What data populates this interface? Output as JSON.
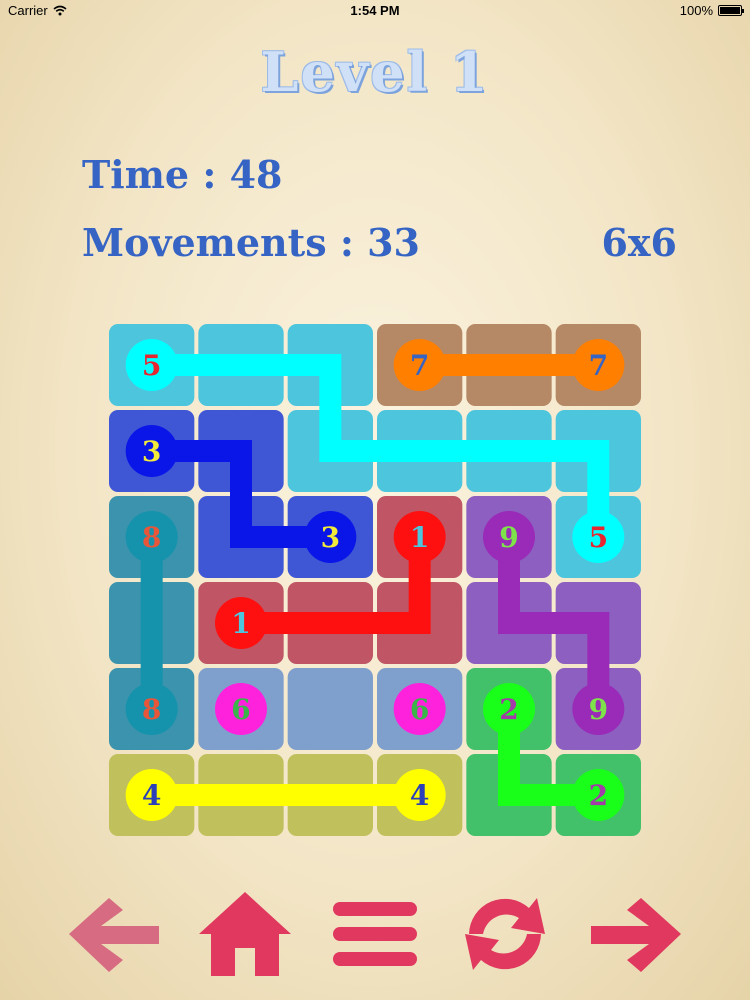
{
  "status_bar": {
    "carrier": "Carrier",
    "time": "1:54 PM",
    "battery": "100%"
  },
  "header": {
    "level_title": "Level  1"
  },
  "stats": {
    "time": "Time : 48",
    "movements": "Movements : 33",
    "grid_size": "6x6"
  },
  "board": {
    "rows": 6,
    "cols": 6,
    "cell_colors": [
      [
        "#4dc5dd",
        "#4dc5dd",
        "#4dc5dd",
        "#b58866",
        "#b58866",
        "#b58866"
      ],
      [
        "#3f57d4",
        "#3f57d4",
        "#4dc5dd",
        "#4dc5dd",
        "#4dc5dd",
        "#4dc5dd"
      ],
      [
        "#3b93ad",
        "#3f57d4",
        "#3f57d4",
        "#bf5565",
        "#8c5fc0",
        "#4dc5dd"
      ],
      [
        "#3b93ad",
        "#bf5565",
        "#bf5565",
        "#bf5565",
        "#8c5fc0",
        "#8c5fc0"
      ],
      [
        "#3b93ad",
        "#7f9fcd",
        "#7f9fcd",
        "#7f9fcd",
        "#42c06a",
        "#8c5fc0"
      ],
      [
        "#c0c05c",
        "#c0c05c",
        "#c0c05c",
        "#c0c05c",
        "#42c06a",
        "#42c06a"
      ]
    ],
    "paths": [
      {
        "color": "#00ffff",
        "cells": [
          [
            0,
            0
          ],
          [
            0,
            1
          ],
          [
            0,
            2
          ],
          [
            1,
            2
          ],
          [
            1,
            3
          ],
          [
            1,
            4
          ],
          [
            1,
            5
          ],
          [
            2,
            5
          ]
        ]
      },
      {
        "color": "#ff7f00",
        "cells": [
          [
            0,
            3
          ],
          [
            0,
            4
          ],
          [
            0,
            5
          ]
        ]
      },
      {
        "color": "#0a16e8",
        "cells": [
          [
            1,
            0
          ],
          [
            1,
            1
          ],
          [
            2,
            1
          ],
          [
            2,
            2
          ]
        ]
      },
      {
        "color": "#ff1010",
        "cells": [
          [
            2,
            3
          ],
          [
            3,
            3
          ],
          [
            3,
            2
          ],
          [
            3,
            1
          ]
        ]
      },
      {
        "color": "#9a2ab8",
        "cells": [
          [
            2,
            4
          ],
          [
            3,
            4
          ],
          [
            3,
            5
          ],
          [
            4,
            5
          ]
        ]
      },
      {
        "color": "#1593ac",
        "cells": [
          [
            2,
            0
          ],
          [
            3,
            0
          ],
          [
            4,
            0
          ]
        ]
      },
      {
        "color": "#ffff00",
        "cells": [
          [
            5,
            0
          ],
          [
            5,
            1
          ],
          [
            5,
            2
          ],
          [
            5,
            3
          ]
        ]
      },
      {
        "color": "#19ff19",
        "cells": [
          [
            4,
            4
          ],
          [
            5,
            4
          ],
          [
            5,
            5
          ]
        ]
      }
    ],
    "dots": [
      {
        "row": 0,
        "col": 0,
        "label": "5",
        "dot_color": "#00ffff",
        "text_color": "#e8242e"
      },
      {
        "row": 2,
        "col": 5,
        "label": "5",
        "dot_color": "#00ffff",
        "text_color": "#e8242e"
      },
      {
        "row": 0,
        "col": 3,
        "label": "7",
        "dot_color": "#ff7f00",
        "text_color": "#3564c4"
      },
      {
        "row": 0,
        "col": 5,
        "label": "7",
        "dot_color": "#ff7f00",
        "text_color": "#3564c4"
      },
      {
        "row": 1,
        "col": 0,
        "label": "3",
        "dot_color": "#0a16e8",
        "text_color": "#f2ea3a"
      },
      {
        "row": 2,
        "col": 2,
        "label": "3",
        "dot_color": "#0a16e8",
        "text_color": "#f2ea3a"
      },
      {
        "row": 2,
        "col": 3,
        "label": "1",
        "dot_color": "#ff1010",
        "text_color": "#4dc5dd"
      },
      {
        "row": 3,
        "col": 1,
        "label": "1",
        "dot_color": "#ff1010",
        "text_color": "#4dc5dd"
      },
      {
        "row": 2,
        "col": 0,
        "label": "8",
        "dot_color": "#1593ac",
        "text_color": "#e8563a"
      },
      {
        "row": 4,
        "col": 0,
        "label": "8",
        "dot_color": "#1593ac",
        "text_color": "#e8563a"
      },
      {
        "row": 2,
        "col": 4,
        "label": "9",
        "dot_color": "#9a2ab8",
        "text_color": "#7ee24a"
      },
      {
        "row": 4,
        "col": 5,
        "label": "9",
        "dot_color": "#9a2ab8",
        "text_color": "#7ee24a"
      },
      {
        "row": 4,
        "col": 1,
        "label": "6",
        "dot_color": "#ff22dd",
        "text_color": "#3ab54a"
      },
      {
        "row": 4,
        "col": 3,
        "label": "6",
        "dot_color": "#ff22dd",
        "text_color": "#3ab54a"
      },
      {
        "row": 4,
        "col": 4,
        "label": "2",
        "dot_color": "#19ff19",
        "text_color": "#a23aa8"
      },
      {
        "row": 5,
        "col": 5,
        "label": "2",
        "dot_color": "#19ff19",
        "text_color": "#a23aa8"
      },
      {
        "row": 5,
        "col": 0,
        "label": "4",
        "dot_color": "#ffff00",
        "text_color": "#2a3fb8"
      },
      {
        "row": 5,
        "col": 3,
        "label": "4",
        "dot_color": "#ffff00",
        "text_color": "#2a3fb8"
      }
    ]
  },
  "controls": [
    {
      "name": "back-arrow-icon",
      "color": "#d66b82"
    },
    {
      "name": "home-icon",
      "color": "#e0385e"
    },
    {
      "name": "menu-icon",
      "color": "#e0385e"
    },
    {
      "name": "restart-icon",
      "color": "#e0385e"
    },
    {
      "name": "forward-arrow-icon",
      "color": "#e0385e"
    }
  ]
}
